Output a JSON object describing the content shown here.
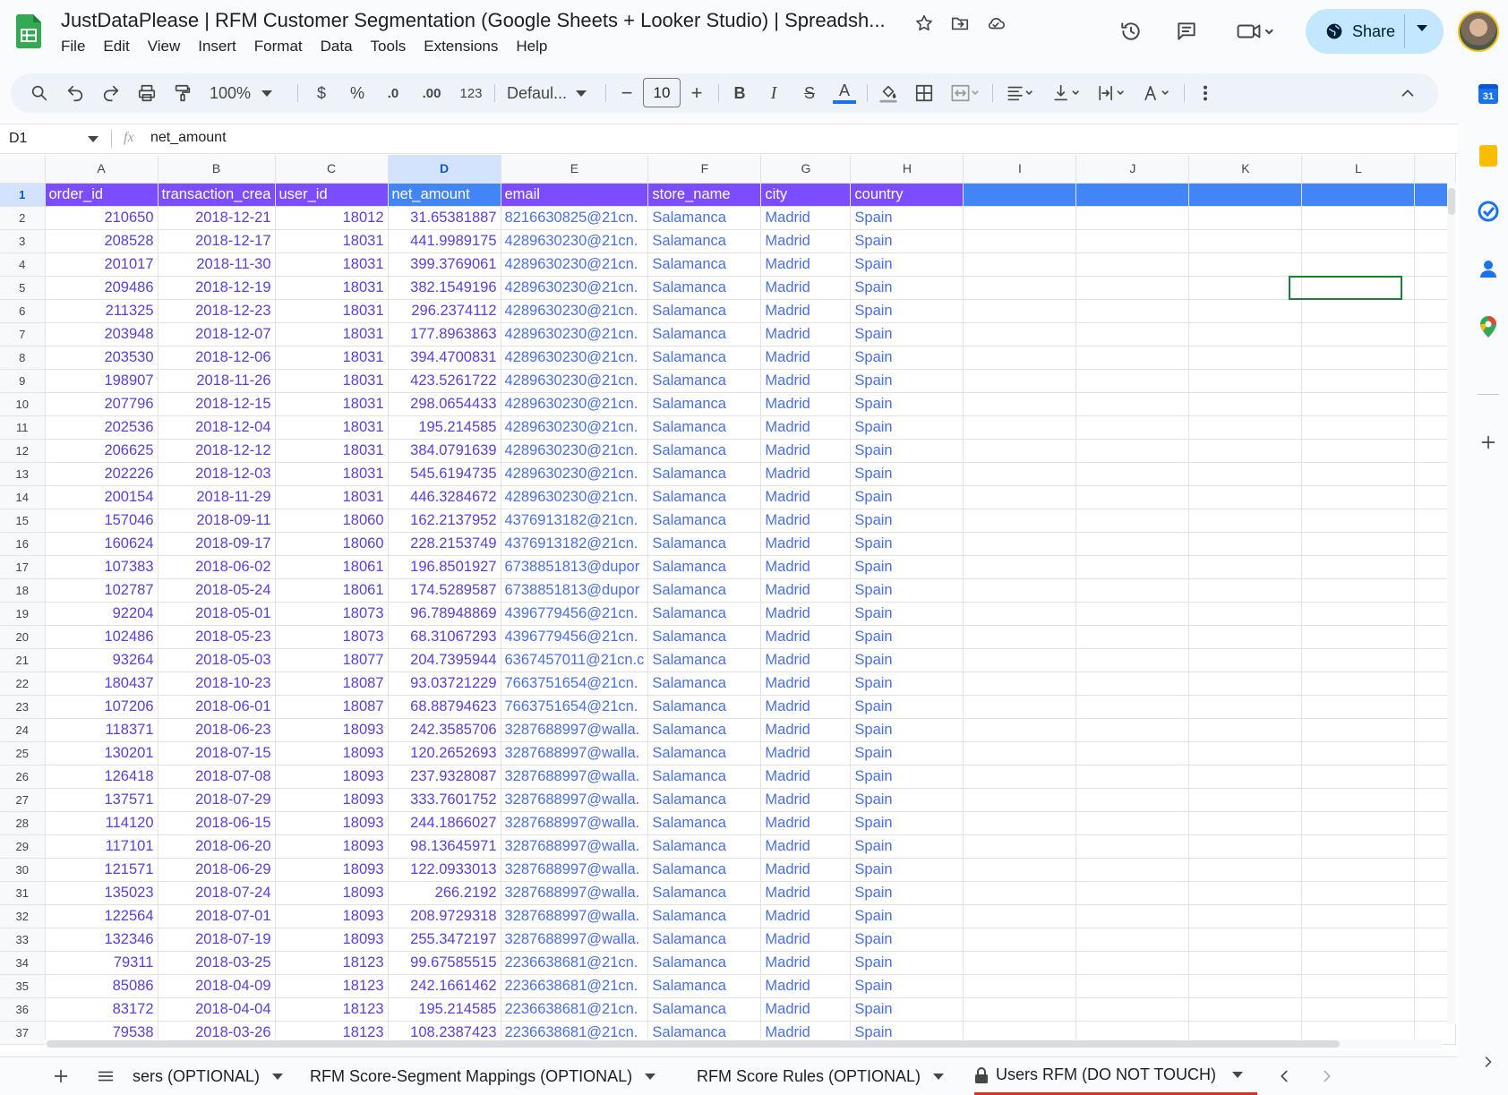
{
  "app": {
    "title": "JustDataPlease | RFM Customer Segmentation (Google Sheets + Looker Studio) | Spreadsh...",
    "share_label": "Share"
  },
  "menu": [
    "File",
    "Edit",
    "View",
    "Insert",
    "Format",
    "Data",
    "Tools",
    "Extensions",
    "Help"
  ],
  "toolbar": {
    "zoom": "100%",
    "currency": "$",
    "percent": "%",
    "dec_decrease": ".0",
    "dec_increase": ".00",
    "number_format": "123",
    "font": "Defaul...",
    "font_size": "10",
    "bold": "B",
    "italic": "I",
    "strike": "S",
    "text_color": "A"
  },
  "formula_bar": {
    "name_box": "D1",
    "fx": "fx",
    "content": "net_amount"
  },
  "columns": [
    "A",
    "B",
    "C",
    "D",
    "E",
    "F",
    "G",
    "H",
    "I",
    "J",
    "K",
    "L"
  ],
  "selected_column": "D",
  "header_row": [
    "order_id",
    "transaction_crea",
    "user_id",
    "net_amount",
    "email",
    "store_name",
    "city",
    "country"
  ],
  "rows": [
    [
      "210650",
      "2018-12-21",
      "18012",
      "31.65381887",
      "8216630825@21cn.",
      "Salamanca",
      "Madrid",
      "Spain"
    ],
    [
      "208528",
      "2018-12-17",
      "18031",
      "441.9989175",
      "4289630230@21cn.",
      "Salamanca",
      "Madrid",
      "Spain"
    ],
    [
      "201017",
      "2018-11-30",
      "18031",
      "399.3769061",
      "4289630230@21cn.",
      "Salamanca",
      "Madrid",
      "Spain"
    ],
    [
      "209486",
      "2018-12-19",
      "18031",
      "382.1549196",
      "4289630230@21cn.",
      "Salamanca",
      "Madrid",
      "Spain"
    ],
    [
      "211325",
      "2018-12-23",
      "18031",
      "296.2374112",
      "4289630230@21cn.",
      "Salamanca",
      "Madrid",
      "Spain"
    ],
    [
      "203948",
      "2018-12-07",
      "18031",
      "177.8963863",
      "4289630230@21cn.",
      "Salamanca",
      "Madrid",
      "Spain"
    ],
    [
      "203530",
      "2018-12-06",
      "18031",
      "394.4700831",
      "4289630230@21cn.",
      "Salamanca",
      "Madrid",
      "Spain"
    ],
    [
      "198907",
      "2018-11-26",
      "18031",
      "423.5261722",
      "4289630230@21cn.",
      "Salamanca",
      "Madrid",
      "Spain"
    ],
    [
      "207796",
      "2018-12-15",
      "18031",
      "298.0654433",
      "4289630230@21cn.",
      "Salamanca",
      "Madrid",
      "Spain"
    ],
    [
      "202536",
      "2018-12-04",
      "18031",
      "195.214585",
      "4289630230@21cn.",
      "Salamanca",
      "Madrid",
      "Spain"
    ],
    [
      "206625",
      "2018-12-12",
      "18031",
      "384.0791639",
      "4289630230@21cn.",
      "Salamanca",
      "Madrid",
      "Spain"
    ],
    [
      "202226",
      "2018-12-03",
      "18031",
      "545.6194735",
      "4289630230@21cn.",
      "Salamanca",
      "Madrid",
      "Spain"
    ],
    [
      "200154",
      "2018-11-29",
      "18031",
      "446.3284672",
      "4289630230@21cn.",
      "Salamanca",
      "Madrid",
      "Spain"
    ],
    [
      "157046",
      "2018-09-11",
      "18060",
      "162.2137952",
      "4376913182@21cn.",
      "Salamanca",
      "Madrid",
      "Spain"
    ],
    [
      "160624",
      "2018-09-17",
      "18060",
      "228.2153749",
      "4376913182@21cn.",
      "Salamanca",
      "Madrid",
      "Spain"
    ],
    [
      "107383",
      "2018-06-02",
      "18061",
      "196.8501927",
      "6738851813@dupor",
      "Salamanca",
      "Madrid",
      "Spain"
    ],
    [
      "102787",
      "2018-05-24",
      "18061",
      "174.5289587",
      "6738851813@dupor",
      "Salamanca",
      "Madrid",
      "Spain"
    ],
    [
      "92204",
      "2018-05-01",
      "18073",
      "96.78948869",
      "4396779456@21cn.",
      "Salamanca",
      "Madrid",
      "Spain"
    ],
    [
      "102486",
      "2018-05-23",
      "18073",
      "68.31067293",
      "4396779456@21cn.",
      "Salamanca",
      "Madrid",
      "Spain"
    ],
    [
      "93264",
      "2018-05-03",
      "18077",
      "204.7395944",
      "6367457011@21cn.c",
      "Salamanca",
      "Madrid",
      "Spain"
    ],
    [
      "180437",
      "2018-10-23",
      "18087",
      "93.03721229",
      "7663751654@21cn.",
      "Salamanca",
      "Madrid",
      "Spain"
    ],
    [
      "107206",
      "2018-06-01",
      "18087",
      "68.88794623",
      "7663751654@21cn.",
      "Salamanca",
      "Madrid",
      "Spain"
    ],
    [
      "118371",
      "2018-06-23",
      "18093",
      "242.3585706",
      "3287688997@walla.",
      "Salamanca",
      "Madrid",
      "Spain"
    ],
    [
      "130201",
      "2018-07-15",
      "18093",
      "120.2652693",
      "3287688997@walla.",
      "Salamanca",
      "Madrid",
      "Spain"
    ],
    [
      "126418",
      "2018-07-08",
      "18093",
      "237.9328087",
      "3287688997@walla.",
      "Salamanca",
      "Madrid",
      "Spain"
    ],
    [
      "137571",
      "2018-07-29",
      "18093",
      "333.7601752",
      "3287688997@walla.",
      "Salamanca",
      "Madrid",
      "Spain"
    ],
    [
      "114120",
      "2018-06-15",
      "18093",
      "244.1866027",
      "3287688997@walla.",
      "Salamanca",
      "Madrid",
      "Spain"
    ],
    [
      "117101",
      "2018-06-20",
      "18093",
      "98.13645971",
      "3287688997@walla.",
      "Salamanca",
      "Madrid",
      "Spain"
    ],
    [
      "121571",
      "2018-06-29",
      "18093",
      "122.0933013",
      "3287688997@walla.",
      "Salamanca",
      "Madrid",
      "Spain"
    ],
    [
      "135023",
      "2018-07-24",
      "18093",
      "266.2192",
      "3287688997@walla.",
      "Salamanca",
      "Madrid",
      "Spain"
    ],
    [
      "122564",
      "2018-07-01",
      "18093",
      "208.9729318",
      "3287688997@walla.",
      "Salamanca",
      "Madrid",
      "Spain"
    ],
    [
      "132346",
      "2018-07-19",
      "18093",
      "255.3472197",
      "3287688997@walla.",
      "Salamanca",
      "Madrid",
      "Spain"
    ],
    [
      "79311",
      "2018-03-25",
      "18123",
      "99.67585515",
      "2236638681@21cn.",
      "Salamanca",
      "Madrid",
      "Spain"
    ],
    [
      "85086",
      "2018-04-09",
      "18123",
      "242.1661462",
      "2236638681@21cn.",
      "Salamanca",
      "Madrid",
      "Spain"
    ],
    [
      "83172",
      "2018-04-04",
      "18123",
      "195.214585",
      "2236638681@21cn.",
      "Salamanca",
      "Madrid",
      "Spain"
    ],
    [
      "79538",
      "2018-03-26",
      "18123",
      "108.2387423",
      "2236638681@21cn.",
      "Salamanca",
      "Madrid",
      "Spain"
    ]
  ],
  "sheet_tabs": [
    {
      "label": "sers (OPTIONAL)",
      "locked": false,
      "active": false
    },
    {
      "label": "RFM Score-Segment Mappings (OPTIONAL)",
      "locked": false,
      "active": false
    },
    {
      "label": "RFM Score Rules (OPTIONAL)",
      "locked": false,
      "active": false
    },
    {
      "label": "Users RFM (DO NOT TOUCH)",
      "locked": true,
      "active": false
    }
  ],
  "colors": {
    "header_fill": "#7c4dff",
    "selection_blue": "#4285f4",
    "share_bg": "#c2e7ff"
  }
}
